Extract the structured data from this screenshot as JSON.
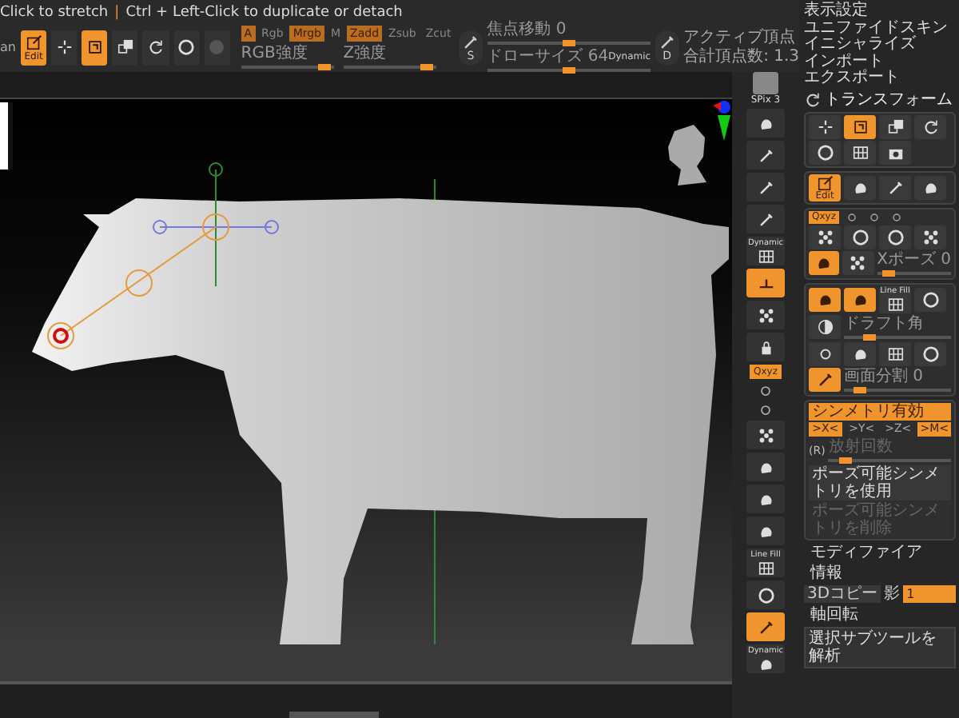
{
  "hint": {
    "left": "Click to stretch",
    "separator": "|",
    "right": "Ctrl + Left-Click to duplicate or detach"
  },
  "toolbar": {
    "cut_label": "an",
    "tools": [
      {
        "label": "Edit",
        "selected": true
      },
      {
        "selected": false
      },
      {
        "selected": true
      },
      {
        "selected": false
      },
      {
        "selected": false
      },
      {
        "selected": false
      },
      {
        "selected": false
      }
    ],
    "color_modes": [
      {
        "label": "A",
        "selected": true
      },
      {
        "label": "Rgb",
        "selected": false
      },
      {
        "label": "Mrgb",
        "selected": true
      },
      {
        "label": "M",
        "selected": false
      }
    ],
    "depth_modes": [
      {
        "label": "Zadd",
        "selected": true
      },
      {
        "label": "Zsub",
        "selected": false
      },
      {
        "label": "Zcut",
        "selected": false
      }
    ],
    "sliders": [
      {
        "label": "RGB強度",
        "level": 0.97
      },
      {
        "label": "Z強度",
        "level": 0.97
      }
    ],
    "brush_buttons": [
      {
        "letter": "S"
      },
      {
        "letter": "D"
      }
    ],
    "brush_sliders": [
      {
        "label": "焦点移動 0",
        "level": 0.5
      },
      {
        "label": "ドローサイズ 64",
        "level": 0.5
      }
    ],
    "dynamic": "Dynamic",
    "stats": [
      "アクティブ頂点",
      "合計頂点数: 1.3"
    ]
  },
  "toolcol": [
    {
      "kind": "thumb",
      "label": "SPix 3"
    },
    {
      "kind": "button",
      "selected": false
    },
    {
      "kind": "button",
      "selected": false
    },
    {
      "kind": "button",
      "selected": false
    },
    {
      "kind": "button",
      "selected": false
    },
    {
      "kind": "button",
      "caption": "Dynamic",
      "selected": false
    },
    {
      "kind": "button",
      "selected": true
    },
    {
      "kind": "button",
      "selected": false
    },
    {
      "kind": "button",
      "selected": false
    },
    {
      "kind": "tab",
      "label": "Qxyz",
      "selected": true
    },
    {
      "kind": "small",
      "selected": false
    },
    {
      "kind": "small",
      "selected": false
    },
    {
      "kind": "button",
      "selected": false
    },
    {
      "kind": "button",
      "selected": false
    },
    {
      "kind": "button",
      "selected": false
    },
    {
      "kind": "button",
      "selected": false
    },
    {
      "kind": "button",
      "caption": "Line Fill",
      "selected": false
    },
    {
      "kind": "button",
      "selected": false
    },
    {
      "kind": "button",
      "selected": true
    },
    {
      "kind": "button",
      "caption": "Dynamic",
      "selected": false
    }
  ],
  "menu": [
    "表示設定",
    "ユニファイドスキン",
    "イニシャライズ",
    "インポート",
    "エクスポート"
  ],
  "panel": {
    "title": "トランスフォーム",
    "blocks": [
      {
        "kind": "card",
        "rows": [
          {
            "kind": "buttons",
            "items": [
              {
                "selected": false
              },
              {
                "selected": true
              },
              {
                "selected": false
              },
              {
                "selected": false
              }
            ]
          },
          {
            "kind": "buttons",
            "items": [
              {
                "selected": false
              },
              {
                "selected": false
              },
              {
                "selected": false
              }
            ]
          }
        ]
      },
      {
        "kind": "card",
        "rows": [
          {
            "kind": "buttons",
            "items": [
              {
                "label": "Edit",
                "selected": true
              },
              {
                "selected": false
              },
              {
                "selected": false
              },
              {
                "selected": false
              }
            ]
          }
        ]
      },
      {
        "kind": "card",
        "rows": [
          {
            "kind": "tabs",
            "items": [
              {
                "label": "Qxyz",
                "selected": true
              },
              {
                "selected": false
              },
              {
                "selected": false
              },
              {
                "selected": false
              }
            ]
          },
          {
            "kind": "buttons",
            "items": [
              {
                "selected": false
              },
              {
                "selected": false
              },
              {
                "selected": false
              },
              {
                "selected": false
              }
            ]
          },
          {
            "kind": "slider_row",
            "items": [
              {
                "selected": true
              },
              {
                "selected": false
              }
            ],
            "label": "Xポーズ 0",
            "level": 0.1
          }
        ]
      },
      {
        "kind": "card",
        "rows": [
          {
            "kind": "buttons",
            "items": [
              {
                "selected": true
              },
              {
                "selected": true
              },
              {
                "caption": "Line Fill",
                "selected": false
              },
              {
                "selected": false
              }
            ]
          },
          {
            "kind": "slider_row",
            "items": [
              {
                "selected": false
              }
            ],
            "label": "ドラフト角",
            "level": 0.2
          },
          {
            "kind": "buttons",
            "items": [
              {
                "selected": false
              },
              {
                "selected": false
              },
              {
                "selected": false
              },
              {
                "selected": false
              }
            ]
          },
          {
            "kind": "slider_row",
            "items": [
              {
                "selected": true
              }
            ],
            "label": "画面分割 0",
            "level": 0.1
          }
        ]
      },
      {
        "kind": "card",
        "rows": [
          {
            "kind": "bar",
            "label": "シンメトリ有効",
            "selected": true
          },
          {
            "kind": "axes",
            "items": [
              {
                "label": ">X<",
                "selected": true
              },
              {
                "label": ">Y<",
                "selected": false
              },
              {
                "label": ">Z<",
                "selected": false
              },
              {
                "label": ">M<",
                "selected": true
              }
            ]
          },
          {
            "kind": "radial",
            "tag": "(R)",
            "label": "放射回数",
            "level": 0.1
          },
          {
            "kind": "action",
            "label": "ポーズ可能シンメトリを使用",
            "disabled": false
          },
          {
            "kind": "action",
            "label": "ポーズ可能シンメトリを削除",
            "disabled": true
          }
        ]
      },
      {
        "kind": "heading",
        "label": "モディファイア"
      },
      {
        "kind": "heading",
        "label": "情報"
      },
      {
        "kind": "fields",
        "items": [
          {
            "label": "3Dコピー"
          },
          {
            "label": "影"
          },
          {
            "value": "1"
          }
        ]
      },
      {
        "kind": "heading",
        "label": "軸回転"
      },
      {
        "kind": "action_block",
        "label": "選択サブツールを解析"
      }
    ]
  }
}
